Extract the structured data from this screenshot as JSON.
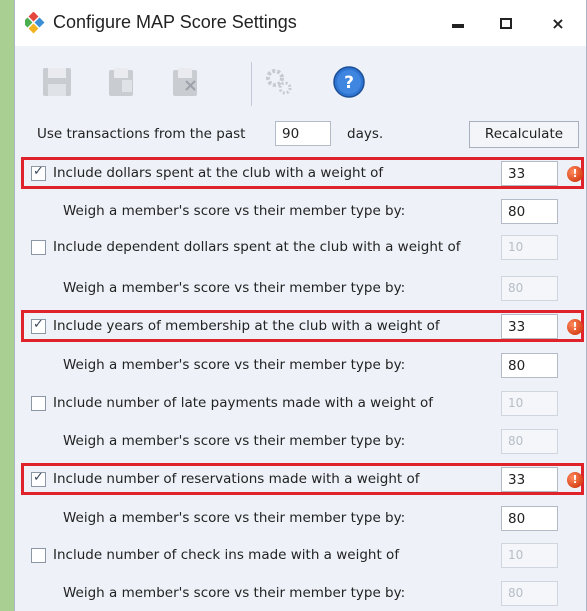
{
  "window": {
    "title": "Configure MAP Score Settings",
    "minimize_label": "",
    "close_label": "×"
  },
  "toolbar": {
    "items": [
      "save-icon",
      "copy-icon",
      "delete-icon",
      "settings-icon",
      "help-icon"
    ]
  },
  "transactions": {
    "prefix": "Use transactions from the past",
    "value": "90",
    "suffix": "days.",
    "recalculate_label": "Recalculate"
  },
  "criteria": [
    {
      "label": "Include dollars spent at the club with a weight of",
      "checked": true,
      "weight": "33",
      "weigh_label": "Weigh a member's score vs their member type by:",
      "type_weight": "80",
      "enabled": true
    },
    {
      "label": "Include dependent dollars spent at the club with a weight of",
      "checked": false,
      "weight": "10",
      "weigh_label": "Weigh a member's score vs their member type by:",
      "type_weight": "80",
      "enabled": false
    },
    {
      "label": "Include years of membership at the club with a weight of",
      "checked": true,
      "weight": "33",
      "weigh_label": "Weigh a member's score vs their member type by:",
      "type_weight": "80",
      "enabled": true
    },
    {
      "label": "Include number of late payments made with a weight of",
      "checked": false,
      "weight": "10",
      "weigh_label": "Weigh a member's score vs their member type by:",
      "type_weight": "80",
      "enabled": false
    },
    {
      "label": "Include number of reservations made with a weight of",
      "checked": true,
      "weight": "33",
      "weigh_label": "Weigh a member's score vs their member type by:",
      "type_weight": "80",
      "enabled": true
    },
    {
      "label": "Include number of check ins made with a weight of",
      "checked": false,
      "weight": "10",
      "weigh_label": "Weigh a member's score vs their member type by:",
      "type_weight": "80",
      "enabled": false
    }
  ],
  "colors": {
    "highlight": "#e0222a",
    "warning": "#d8431a",
    "background": "#a9cf93"
  }
}
